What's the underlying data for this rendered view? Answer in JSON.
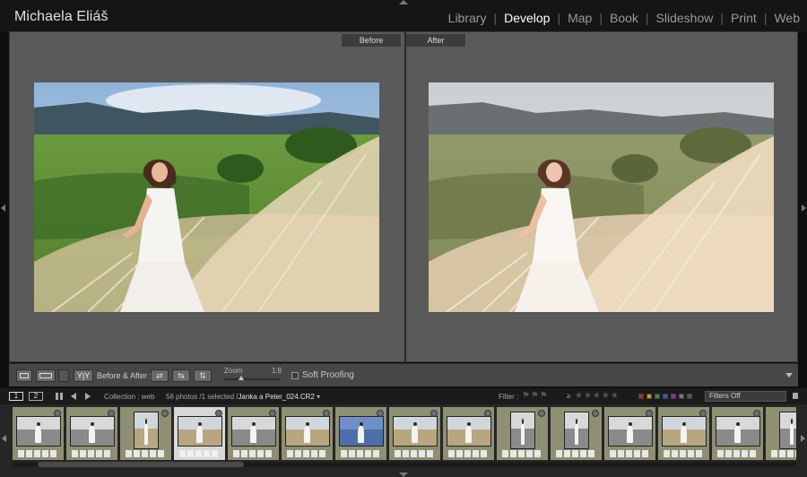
{
  "app": {
    "owner": "Michaela Eliáš",
    "modules": [
      {
        "label": "Library",
        "active": false
      },
      {
        "label": "Develop",
        "active": true
      },
      {
        "label": "Map",
        "active": false
      },
      {
        "label": "Book",
        "active": false
      },
      {
        "label": "Slideshow",
        "active": false
      },
      {
        "label": "Print",
        "active": false
      },
      {
        "label": "Web",
        "active": false
      }
    ]
  },
  "viewer": {
    "before_label": "Before",
    "after_label": "After"
  },
  "toolbar": {
    "view_mode": "Y|Y",
    "before_after_label": "Before & After :",
    "zoom_label": "Zoom",
    "zoom_value": "1:8",
    "soft_proofing_label": "Soft Proofing",
    "soft_proofing_checked": false
  },
  "filmstrip_nav": {
    "monitor_1": "1",
    "monitor_2": "2",
    "source": "Collection : web",
    "count": "56 photos /1 selected /",
    "filename": "Janka a Peter_024.CR2",
    "filter_label": "Filter :",
    "filter_attribute": "≥",
    "stars_glyphs": "★★★★★",
    "filter_preset": "Filters Off",
    "swatch_colors": [
      "#b02a2a",
      "#b9a52a",
      "#3e8a3a",
      "#3a5fa6",
      "#7a3d9a",
      "#777777",
      "#555555"
    ]
  },
  "filmstrip": {
    "thumbnails": [
      {
        "kind": "land",
        "tone": "bw"
      },
      {
        "kind": "land",
        "tone": "bw"
      },
      {
        "kind": "port",
        "tone": "color"
      },
      {
        "kind": "land",
        "tone": "color",
        "selected": true
      },
      {
        "kind": "land",
        "tone": "bw"
      },
      {
        "kind": "land",
        "tone": "color"
      },
      {
        "kind": "land",
        "tone": "blue"
      },
      {
        "kind": "land",
        "tone": "color"
      },
      {
        "kind": "land",
        "tone": "color"
      },
      {
        "kind": "port",
        "tone": "bw"
      },
      {
        "kind": "port",
        "tone": "bw"
      },
      {
        "kind": "land",
        "tone": "bw"
      },
      {
        "kind": "land",
        "tone": "color"
      },
      {
        "kind": "land",
        "tone": "bw"
      },
      {
        "kind": "port",
        "tone": "bw"
      }
    ]
  }
}
